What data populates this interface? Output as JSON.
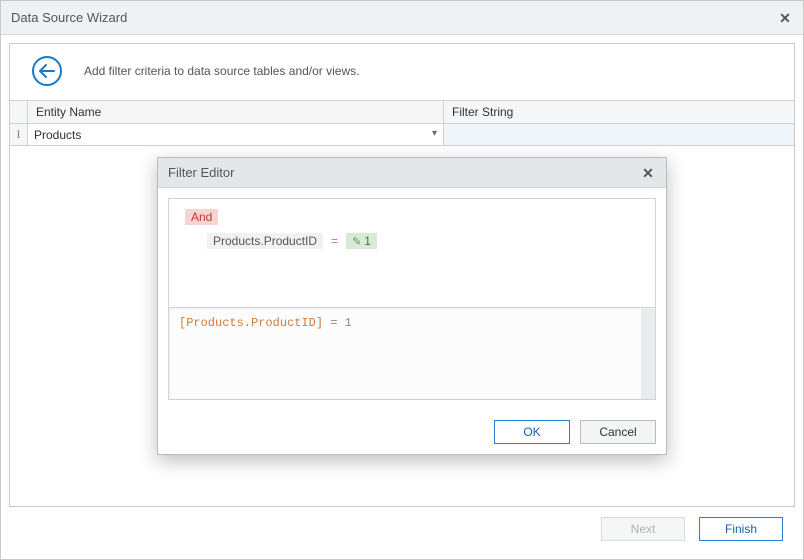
{
  "window": {
    "title": "Data Source Wizard",
    "instruction": "Add filter criteria to data source tables and/or views."
  },
  "grid": {
    "headers": {
      "entity": "Entity Name",
      "filter": "Filter String"
    },
    "rows": [
      {
        "entity": "Products",
        "filter": ""
      }
    ]
  },
  "modal": {
    "title": "Filter Editor",
    "group_op": "And",
    "criteria": [
      {
        "field": "Products.ProductID",
        "op": "=",
        "value": "1"
      }
    ],
    "text_repr": {
      "bracket": "[Products.ProductID]",
      "rest": " = 1"
    },
    "buttons": {
      "ok": "OK",
      "cancel": "Cancel"
    }
  },
  "footer": {
    "next": "Next",
    "finish": "Finish"
  }
}
